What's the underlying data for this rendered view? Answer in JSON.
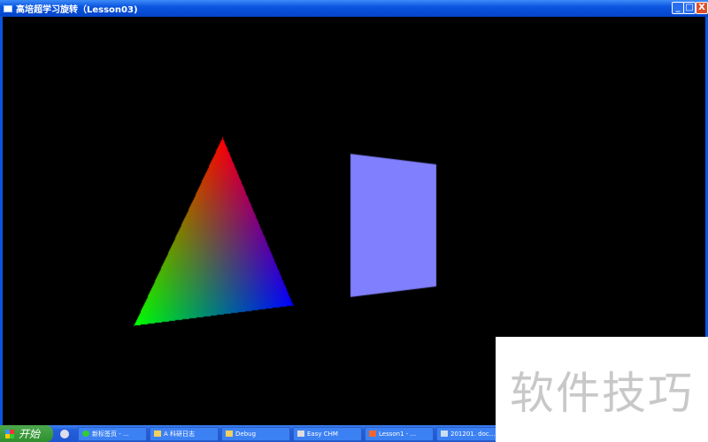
{
  "window": {
    "title": "高培超学习旋转（Lesson03)",
    "minimize": "_",
    "maximize": "□",
    "close": "X"
  },
  "scene": {
    "triangle_colors": [
      "#ff0000",
      "#00ff00",
      "#0000ff"
    ],
    "quad_color": "#8080ff",
    "background": "#000000"
  },
  "taskbar": {
    "start_label": "开始",
    "tasks": [
      {
        "label": "新标签页 - ..."
      },
      {
        "label": "A 科研日志"
      },
      {
        "label": "Debug"
      },
      {
        "label": "Easy CHM"
      },
      {
        "label": "Lesson1 - ..."
      },
      {
        "label": "201201. doc..."
      }
    ]
  },
  "watermark": "软件技巧"
}
